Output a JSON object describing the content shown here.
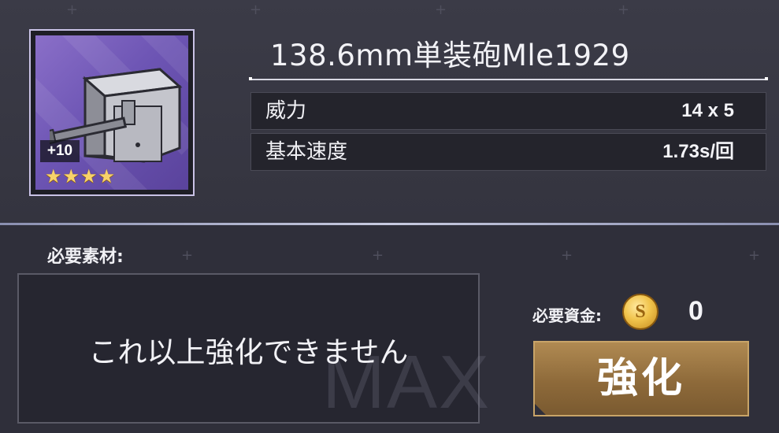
{
  "equipment": {
    "name": "138.6mm単装砲Mle1929",
    "level_badge": "+10",
    "stars": [
      "★",
      "★",
      "★",
      "★"
    ],
    "icon": "naval-gun-turret-icon"
  },
  "stats": [
    {
      "label": "威力",
      "value": "14 x 5"
    },
    {
      "label": "基本速度",
      "value": "1.73s/回"
    }
  ],
  "materials": {
    "label": "必要素材:",
    "message": "これ以上強化できません",
    "watermark": "MAX"
  },
  "funds": {
    "label": "必要資金:",
    "coin_icon": "gold-coin-icon",
    "coin_glyph": "S",
    "value": "0"
  },
  "enhance_button": {
    "label": "強化"
  },
  "colors": {
    "background": "#34343f",
    "rarity_purple": "#6d55b4",
    "star_gold": "#f7d36a",
    "button_bronze": "#8e6a3a"
  }
}
